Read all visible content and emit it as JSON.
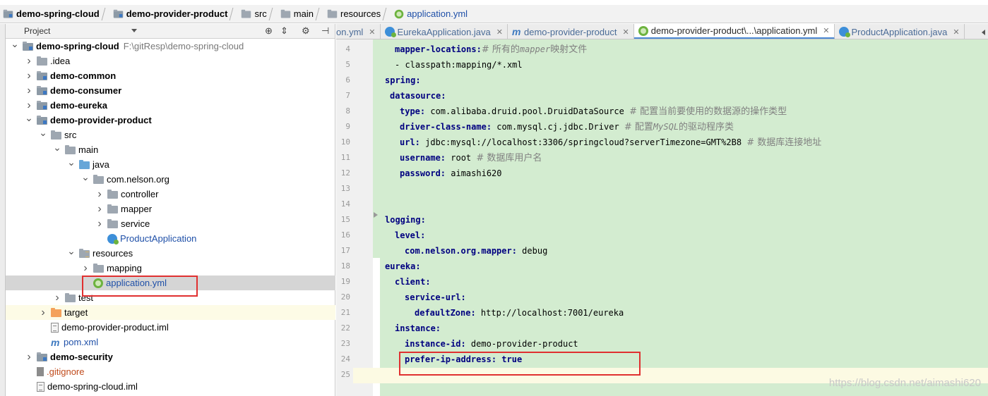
{
  "breadcrumb": [
    {
      "label": "demo-spring-cloud",
      "bold": true
    },
    {
      "label": "demo-provider-product",
      "bold": true
    },
    {
      "label": "src",
      "bold": false
    },
    {
      "label": "main",
      "bold": false
    },
    {
      "label": "resources",
      "bold": false
    },
    {
      "label": "application.yml",
      "bold": false
    }
  ],
  "project_panel": {
    "title": "Project"
  },
  "tree": [
    {
      "label": "demo-spring-cloud",
      "path": "F:\\gitResp\\demo-spring-cloud",
      "depth": 0,
      "arrow": "down",
      "icon": "module-folder",
      "bold": true
    },
    {
      "label": ".idea",
      "depth": 1,
      "arrow": "right",
      "icon": "folder"
    },
    {
      "label": "demo-common",
      "depth": 1,
      "arrow": "right",
      "icon": "module-folder",
      "bold": true
    },
    {
      "label": "demo-consumer",
      "depth": 1,
      "arrow": "right",
      "icon": "module-folder",
      "bold": true
    },
    {
      "label": "demo-eureka",
      "depth": 1,
      "arrow": "right",
      "icon": "module-folder",
      "bold": true
    },
    {
      "label": "demo-provider-product",
      "depth": 1,
      "arrow": "down",
      "icon": "module-folder",
      "bold": true
    },
    {
      "label": "src",
      "depth": 2,
      "arrow": "down",
      "icon": "folder"
    },
    {
      "label": "main",
      "depth": 3,
      "arrow": "down",
      "icon": "folder"
    },
    {
      "label": "java",
      "depth": 4,
      "arrow": "down",
      "icon": "src-folder"
    },
    {
      "label": "com.nelson.org",
      "depth": 5,
      "arrow": "down",
      "icon": "package"
    },
    {
      "label": "controller",
      "depth": 6,
      "arrow": "right",
      "icon": "package"
    },
    {
      "label": "mapper",
      "depth": 6,
      "arrow": "right",
      "icon": "package"
    },
    {
      "label": "service",
      "depth": 6,
      "arrow": "right",
      "icon": "package"
    },
    {
      "label": "ProductApplication",
      "depth": 6,
      "arrow": "none",
      "icon": "spring-class",
      "blue": true
    },
    {
      "label": "resources",
      "depth": 4,
      "arrow": "down",
      "icon": "resources-folder"
    },
    {
      "label": "mapping",
      "depth": 5,
      "arrow": "right",
      "icon": "package"
    },
    {
      "label": "application.yml",
      "depth": 5,
      "arrow": "none",
      "icon": "spring-file",
      "blue": true,
      "selected": true
    },
    {
      "label": "test",
      "depth": 3,
      "arrow": "right",
      "icon": "folder"
    },
    {
      "label": "target",
      "depth": 2,
      "arrow": "right",
      "icon": "target-folder",
      "highlight": true
    },
    {
      "label": "demo-provider-product.iml",
      "depth": 2,
      "arrow": "none",
      "icon": "file"
    },
    {
      "label": "pom.xml",
      "depth": 2,
      "arrow": "none",
      "icon": "maven",
      "blue": true
    },
    {
      "label": "demo-security",
      "depth": 1,
      "arrow": "right",
      "icon": "module-folder",
      "bold": true
    },
    {
      "label": ".gitignore",
      "depth": 1,
      "arrow": "none",
      "icon": "git",
      "red": true
    },
    {
      "label": "demo-spring-cloud.iml",
      "depth": 1,
      "arrow": "none",
      "icon": "file"
    }
  ],
  "tabs": [
    {
      "label": "on.yml",
      "icon": "none",
      "active": false
    },
    {
      "label": "EurekaApplication.java",
      "icon": "spring-class",
      "active": false
    },
    {
      "label": "demo-provider-product",
      "icon": "maven",
      "active": false
    },
    {
      "label": "demo-provider-product\\...\\application.yml",
      "icon": "spring-file",
      "active": true
    },
    {
      "label": "ProductApplication.java",
      "icon": "spring-class",
      "active": false
    }
  ],
  "code": [
    {
      "n": "4",
      "indent": 1,
      "key": "mapper-locations:",
      "val": "",
      "cmt": "# 所有的",
      "cmt_it": "mapper",
      "cmt2": "映射文件"
    },
    {
      "n": "5",
      "indent": 1,
      "key": "",
      "val": "- classpath:mapping/*.xml",
      "cmt": ""
    },
    {
      "n": "6",
      "indent": 0,
      "key": "spring:",
      "val": "",
      "cmt": ""
    },
    {
      "n": "7",
      "indent": 0.5,
      "key": "datasource:",
      "val": "",
      "cmt": ""
    },
    {
      "n": "8",
      "indent": 1.5,
      "key": "type:",
      "val": " com.alibaba.druid.pool.DruidDataSource ",
      "cmt": "# 配置当前要使用的数据源的操作类型"
    },
    {
      "n": "9",
      "indent": 1.5,
      "key": "driver-class-name:",
      "val": " com.mysql.cj.jdbc.Driver ",
      "cmt": "# 配置",
      "cmt_it": "MySQL",
      "cmt2": "的驱动程序类"
    },
    {
      "n": "10",
      "indent": 1.5,
      "key": "url:",
      "val": " jdbc:mysql://localhost:3306/springcloud?serverTimezone=GMT%2B8 ",
      "cmt": "# 数据库连接地址"
    },
    {
      "n": "11",
      "indent": 1.5,
      "key": "username:",
      "val": " root ",
      "cmt": "# 数据库用户名"
    },
    {
      "n": "12",
      "indent": 1.5,
      "key": "password:",
      "val": " aimashi620",
      "cmt": ""
    },
    {
      "n": "13",
      "indent": 0,
      "key": "",
      "val": "",
      "cmt": ""
    },
    {
      "n": "14",
      "indent": 0,
      "key": "",
      "val": "",
      "cmt": ""
    },
    {
      "n": "15",
      "indent": 0,
      "key": "logging:",
      "val": "",
      "cmt": ""
    },
    {
      "n": "16",
      "indent": 1,
      "key": "level:",
      "val": "",
      "cmt": ""
    },
    {
      "n": "17",
      "indent": 2,
      "key": "com.nelson.org.mapper:",
      "val": " debug",
      "cmt": ""
    },
    {
      "n": "18",
      "indent": 0,
      "key": "eureka:",
      "val": "",
      "cmt": ""
    },
    {
      "n": "19",
      "indent": 1,
      "key": "client:",
      "val": "",
      "cmt": ""
    },
    {
      "n": "20",
      "indent": 2,
      "key": "service-url:",
      "val": "",
      "cmt": ""
    },
    {
      "n": "21",
      "indent": 3,
      "key": "defaultZone:",
      "val": " http://localhost:7001/eureka",
      "cmt": ""
    },
    {
      "n": "22",
      "indent": 1,
      "key": "instance:",
      "val": "",
      "cmt": ""
    },
    {
      "n": "23",
      "indent": 2,
      "key": "instance-id:",
      "val": " demo-provider-product",
      "cmt": ""
    },
    {
      "n": "24",
      "indent": 2,
      "key": "prefer-ip-address:",
      "val": " true",
      "cmt": "",
      "valbold": true
    },
    {
      "n": "25",
      "indent": 0,
      "key": "",
      "val": "",
      "cmt": ""
    }
  ],
  "watermark": "https://blog.csdn.net/aimashi620",
  "colors": {
    "editor_green": "#d3ecd0",
    "key_blue": "#000080",
    "annotation_red": "#e03030",
    "selection_gray": "#d5d5d5"
  }
}
